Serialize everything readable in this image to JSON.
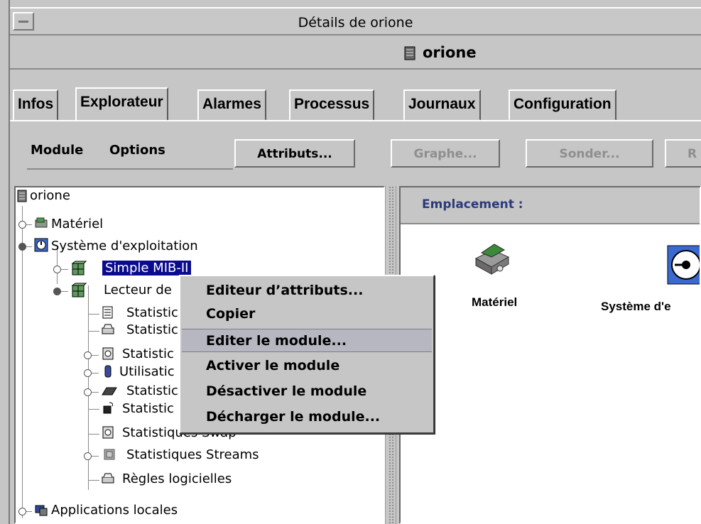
{
  "window": {
    "title": "Détails de orione",
    "host": "orione"
  },
  "tabs": [
    {
      "label": "Infos"
    },
    {
      "label": "Explorateur"
    },
    {
      "label": "Alarmes"
    },
    {
      "label": "Processus"
    },
    {
      "label": "Journaux"
    },
    {
      "label": "Configuration"
    }
  ],
  "toolbar": {
    "menu_module": "Module",
    "menu_options": "Options",
    "attributs": "Attributs...",
    "graphe": "Graphe...",
    "sonder": "Sonder...",
    "cut_button": "R"
  },
  "tree": {
    "root": "orione",
    "items": [
      {
        "label": "Matériel"
      },
      {
        "label": "Système d'exploitation"
      },
      {
        "label": "Simple MIB-II"
      },
      {
        "label": "Lecteur de"
      },
      {
        "label": "Statistic"
      },
      {
        "label": "Statistic"
      },
      {
        "label": "Statistic"
      },
      {
        "label": "Utilisatic"
      },
      {
        "label": "Statistic"
      },
      {
        "label": "Statistic"
      },
      {
        "label": "Statistiques Swap"
      },
      {
        "label": "Statistiques Streams"
      },
      {
        "label": "Règles logicielles"
      },
      {
        "label": "Applications locales"
      }
    ]
  },
  "right": {
    "emplacement": "Emplacement :",
    "icons": [
      {
        "label": "Matériel",
        "icon": "hardware-icon"
      },
      {
        "label": "Système d'e",
        "icon": "os-clock-icon"
      }
    ]
  },
  "context_menu": {
    "items": [
      {
        "label": "Editeur d’attributs..."
      },
      {
        "label": "Copier"
      },
      {
        "label": "Editer le module...",
        "highlighted": true
      },
      {
        "label": "Activer le module"
      },
      {
        "label": "Désactiver le module"
      },
      {
        "label": "Décharger le module..."
      }
    ]
  },
  "colors": {
    "background": "#c6c6c6",
    "selection": "#0b0b90",
    "menu_highlight": "#b7b7c2",
    "emplacement_text": "#2b3b7a"
  }
}
